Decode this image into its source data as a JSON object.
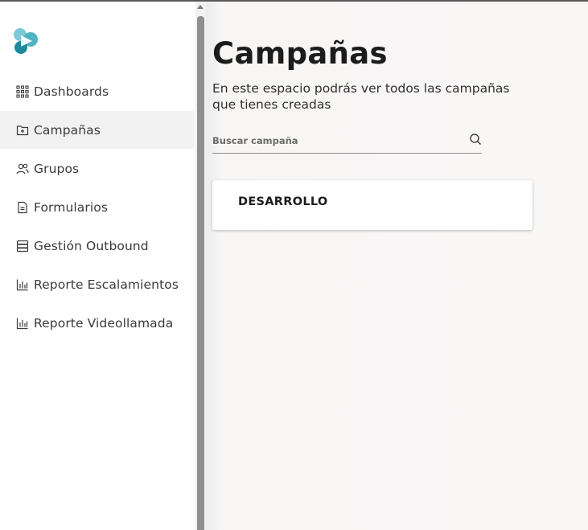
{
  "sidebar": {
    "items": [
      {
        "label": "Dashboards",
        "icon": "grid-icon"
      },
      {
        "label": "Campañas",
        "icon": "folder-plus-icon",
        "active": true
      },
      {
        "label": "Grupos",
        "icon": "users-icon"
      },
      {
        "label": "Formularios",
        "icon": "document-icon"
      },
      {
        "label": "Gestión Outbound",
        "icon": "database-icon"
      },
      {
        "label": "Reporte Escalamientos",
        "icon": "bar-chart-icon"
      },
      {
        "label": "Reporte Videollamada",
        "icon": "bar-chart-icon"
      }
    ]
  },
  "main": {
    "title": "Campañas",
    "subtitle": "En este espacio podrás ver todos las campañas que tienes creadas",
    "search": {
      "placeholder": "Buscar campaña",
      "value": ""
    },
    "campaigns": [
      {
        "name": "DESARROLLO"
      }
    ]
  },
  "colors": {
    "logo_primary": "#1e8a9a",
    "logo_light": "#7ccad6",
    "active_bg": "#f2f2f2"
  }
}
